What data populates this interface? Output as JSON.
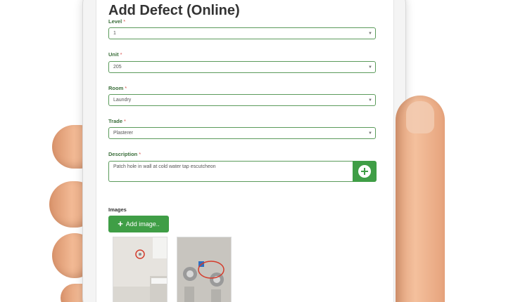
{
  "form": {
    "title": "Add Defect (Online)",
    "required_mark": "*",
    "level": {
      "label": "Level",
      "value": "1"
    },
    "unit": {
      "label": "Unit",
      "value": "205"
    },
    "room": {
      "label": "Room",
      "value": "Laundry"
    },
    "trade": {
      "label": "Trade",
      "value": "Plasterer"
    },
    "description": {
      "label": "Description",
      "value": "Patch hole in wall at cold water tap escutcheon"
    },
    "images": {
      "label": "Images",
      "add_button_label": "Add image.."
    }
  },
  "icons": {
    "description_add": "plus-circle-icon",
    "add_image": "plus-icon",
    "dropdown": "chevron-down-icon"
  },
  "colors": {
    "accent": "#3f9e46",
    "label": "#3a6e3a",
    "required": "#d9534f"
  }
}
